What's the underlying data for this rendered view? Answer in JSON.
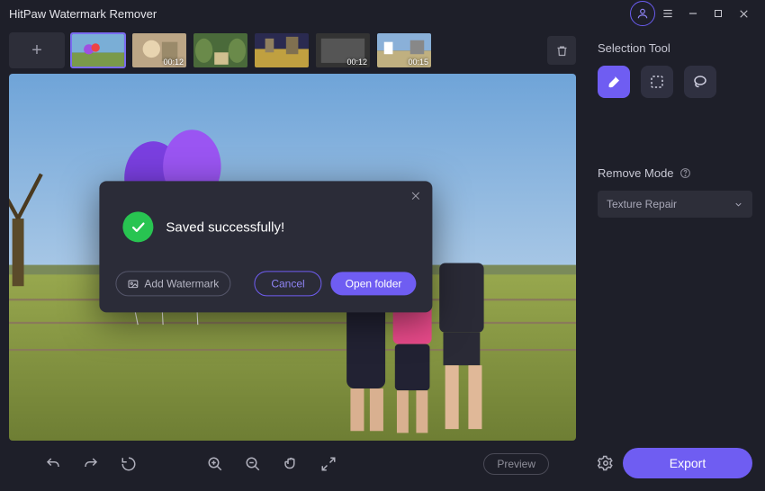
{
  "title": "HitPaw Watermark Remover",
  "thumbnails": [
    {
      "duration": "",
      "selected": true
    },
    {
      "duration": "00:12",
      "selected": false
    },
    {
      "duration": "",
      "selected": false
    },
    {
      "duration": "",
      "selected": false
    },
    {
      "duration": "00:12",
      "selected": false
    },
    {
      "duration": "00:15",
      "selected": false
    }
  ],
  "bottom": {
    "preview_label": "Preview"
  },
  "right": {
    "selection_label": "Selection Tool",
    "remove_label": "Remove Mode",
    "dropdown_value": "Texture Repair",
    "export_label": "Export"
  },
  "modal": {
    "message": "Saved successfully!",
    "add_watermark_label": "Add Watermark",
    "cancel_label": "Cancel",
    "open_label": "Open folder"
  }
}
